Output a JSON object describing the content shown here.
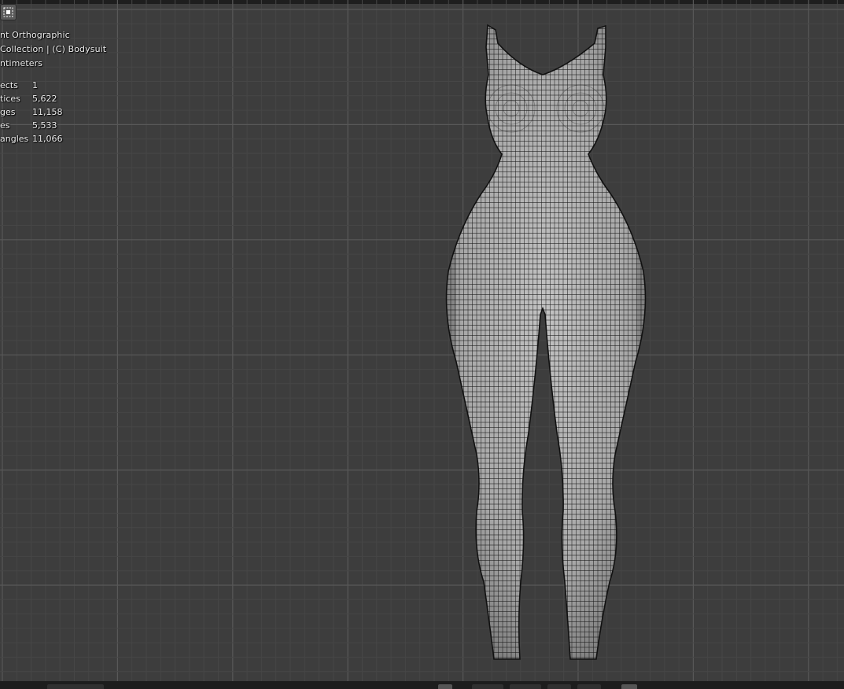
{
  "viewport": {
    "view_name": "nt Orthographic",
    "collection_line": "Collection | (C) Bodysuit",
    "units": "ntimeters",
    "stats": [
      {
        "label": "ects",
        "value": "1"
      },
      {
        "label": "tices",
        "value": "5,622"
      },
      {
        "label": "ges",
        "value": "11,158"
      },
      {
        "label": "es",
        "value": "5,533"
      },
      {
        "label": "angles",
        "value": "11,066"
      }
    ]
  },
  "colors": {
    "viewport_bg": "#3d3d3d",
    "grid_minor": "#464646",
    "grid_major": "#585858",
    "mesh_fill": "#a9a9a9",
    "wire": "#1a1a1a"
  },
  "icons": {
    "mode": "select-box-icon"
  },
  "object": {
    "name": "Bodysuit",
    "display": "wireframe-on-shaded"
  }
}
